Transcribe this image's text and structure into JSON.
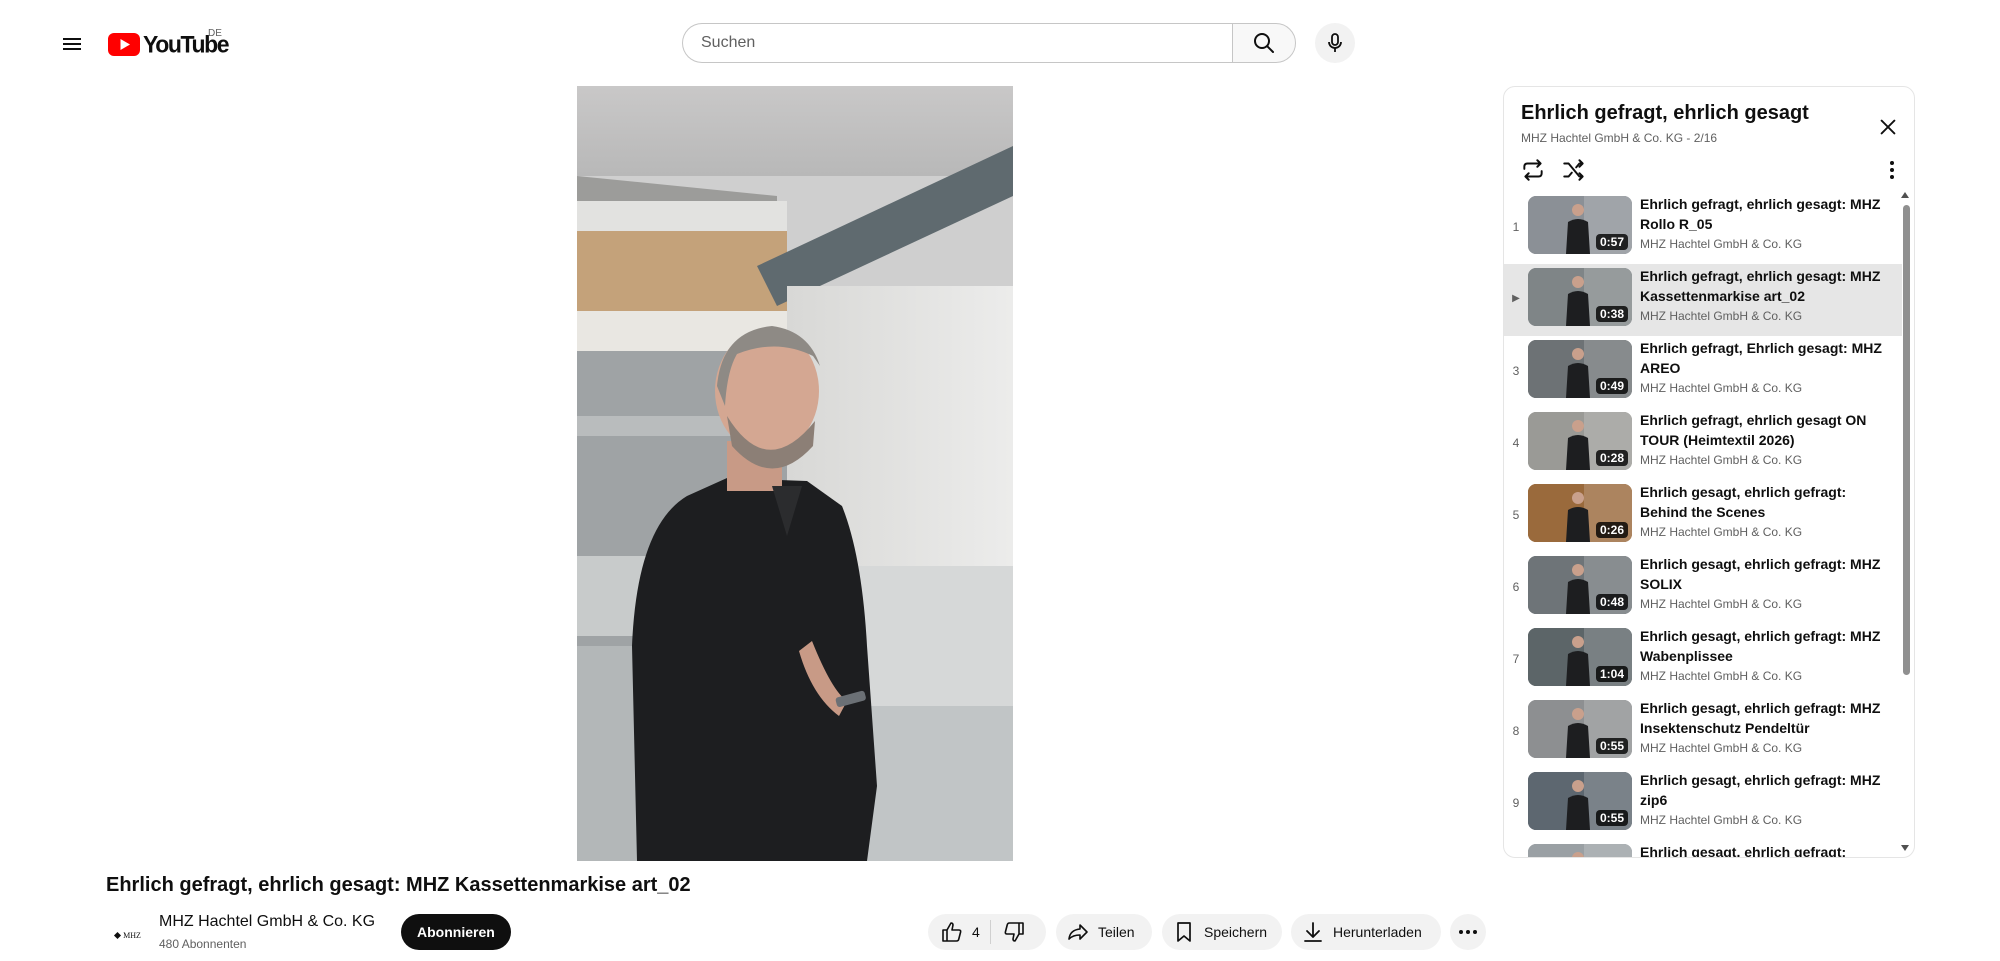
{
  "header": {
    "logo_text": "YouTube",
    "region": "DE",
    "search_placeholder": "Suchen"
  },
  "video": {
    "title": "Ehrlich gefragt, ehrlich gesagt: MHZ Kassettenmarkise art_02",
    "channel_name": "MHZ Hachtel GmbH & Co. KG",
    "channel_avatar_text": "MHZ",
    "subscribers": "480 Abonnenten",
    "subscribe_label": "Abonnieren",
    "like_count": "4",
    "share_label": "Teilen",
    "save_label": "Speichern",
    "download_label": "Herunterladen"
  },
  "playlist": {
    "title": "Ehrlich gefragt, ehrlich gesagt",
    "subtitle": "MHZ Hachtel GmbH & Co. KG - 2/16",
    "play_marker": "▶",
    "items": [
      {
        "index": "1",
        "title": "Ehrlich gefragt, ehrlich gesagt: MHZ Rollo R_05",
        "channel": "MHZ Hachtel GmbH & Co. KG",
        "duration": "0:57",
        "active": false,
        "thumb_bg": "#8b9096"
      },
      {
        "index": "2",
        "title": "Ehrlich gefragt, ehrlich gesagt: MHZ Kassettenmarkise art_02",
        "channel": "MHZ Hachtel GmbH & Co. KG",
        "duration": "0:38",
        "active": true,
        "thumb_bg": "#7f8587"
      },
      {
        "index": "3",
        "title": "Ehrlich gefragt, Ehrlich gesagt: MHZ AREO",
        "channel": "MHZ Hachtel GmbH & Co. KG",
        "duration": "0:49",
        "active": false,
        "thumb_bg": "#6d7275"
      },
      {
        "index": "4",
        "title": "Ehrlich gefragt, ehrlich gesagt ON TOUR (Heimtextil 2026)",
        "channel": "MHZ Hachtel GmbH & Co. KG",
        "duration": "0:28",
        "active": false,
        "thumb_bg": "#9a9a96"
      },
      {
        "index": "5",
        "title": "Ehrlich gesagt, ehrlich gefragt: Behind the Scenes",
        "channel": "MHZ Hachtel GmbH & Co. KG",
        "duration": "0:26",
        "active": false,
        "thumb_bg": "#9a6a3c"
      },
      {
        "index": "6",
        "title": "Ehrlich gesagt, ehrlich gefragt: MHZ SOLIX",
        "channel": "MHZ Hachtel GmbH & Co. KG",
        "duration": "0:48",
        "active": false,
        "thumb_bg": "#6e7478"
      },
      {
        "index": "7",
        "title": "Ehrlich gesagt, ehrlich gefragt: MHZ Wabenplissee",
        "channel": "MHZ Hachtel GmbH & Co. KG",
        "duration": "1:04",
        "active": false,
        "thumb_bg": "#5c6568"
      },
      {
        "index": "8",
        "title": "Ehrlich gesagt, ehrlich gefragt: MHZ Insektenschutz Pendeltür",
        "channel": "MHZ Hachtel GmbH & Co. KG",
        "duration": "0:55",
        "active": false,
        "thumb_bg": "#8d8f91"
      },
      {
        "index": "9",
        "title": "Ehrlich gesagt, ehrlich gefragt: MHZ zip6",
        "channel": "MHZ Hachtel GmbH & Co. KG",
        "duration": "0:55",
        "active": false,
        "thumb_bg": "#5d6770"
      },
      {
        "index": "10",
        "title": "Ehrlich gesagt, ehrlich gefragt:",
        "channel": "",
        "duration": "",
        "active": false,
        "thumb_bg": "#9aa0a4"
      }
    ]
  },
  "colors": {
    "brand_red": "#ff0000",
    "text_primary": "#0f0f0f",
    "text_secondary": "#606060",
    "active_row": "#e6e6e6"
  },
  "icons": {
    "menu": "hamburger-icon",
    "search": "search-icon",
    "mic": "microphone-icon",
    "like": "thumbs-up-icon",
    "dislike": "thumbs-down-icon",
    "share": "share-arrow-icon",
    "save": "bookmark-icon",
    "download": "download-icon",
    "more": "more-horizontal-icon",
    "close": "close-icon",
    "loop": "loop-icon",
    "shuffle": "shuffle-icon",
    "playlist_menu": "more-vertical-icon"
  }
}
